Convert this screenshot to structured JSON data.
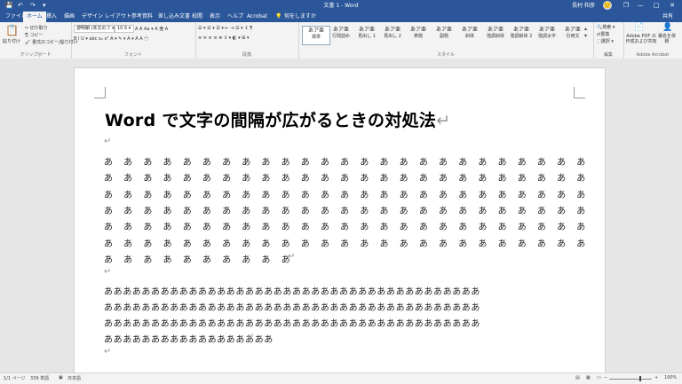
{
  "titlebar": {
    "doc_title": "文書 1 - Word",
    "user": "長村 和彦",
    "avatar": "🙂",
    "minimize": "—",
    "restore": "❐",
    "maximize": "□",
    "close": "✕",
    "save_icon": "💾",
    "undo_icon": "↶",
    "redo_icon": "↷",
    "more_icon": "▾"
  },
  "tabs": {
    "file": "ファイル",
    "home": "ホーム",
    "insert": "挿入",
    "draw": "描画",
    "design": "デザイン",
    "layout": "レイアウト",
    "references": "参考資料",
    "mailings": "差し込み文書",
    "review": "校閲",
    "view": "表示",
    "help": "ヘルプ",
    "acrobat": "Acrobat",
    "tellme": "何をしますか",
    "share": "共有"
  },
  "ribbon": {
    "clipboard": {
      "paste": "貼り付け",
      "cut": "切り取り",
      "copy": "コピー",
      "format_painter": "書式のコピー/貼り付け",
      "label": "クリップボード"
    },
    "font": {
      "font_name": "游明朝 (本文のフ ▾",
      "font_size": "10.5 ▾",
      "label": "フォント",
      "row1_tail": "A A Aa ▾ A 亜 A",
      "row2": "B I U ▾ abc x₂ x² A ▾ ✎ ▾ A ▾ A A ㊀"
    },
    "paragraph": {
      "label": "段落",
      "row1": "☰ ▾ ☰ ▾ ☰ ▾ ⇤ ⇥ ☰ ▾ ↕ ¶",
      "row2": "≡ ≡ ≡ ≡ ≣ ↕ ▾ ◧ ▾ ⊞ ▾"
    },
    "styles": {
      "label": "スタイル",
      "items": [
        {
          "preview": "あア亜",
          "name": "標準"
        },
        {
          "preview": "あア亜",
          "name": "行間詰め"
        },
        {
          "preview": "あア亜",
          "name": "見出し 1"
        },
        {
          "preview": "あア亜",
          "name": "見出し 2"
        },
        {
          "preview": "あア亜",
          "name": "表題"
        },
        {
          "preview": "あア亜",
          "name": "副題"
        },
        {
          "preview": "あア亜",
          "name": "斜体"
        },
        {
          "preview": "あア亜",
          "name": "強調斜体"
        },
        {
          "preview": "あア亜",
          "name": "強調斜体 2"
        },
        {
          "preview": "あア亜",
          "name": "強調太字"
        },
        {
          "preview": "あア亜",
          "name": "引用文"
        }
      ]
    },
    "editing": {
      "find": "検索 ▾",
      "replace": "置換",
      "select": "選択 ▾",
      "label": "編集"
    },
    "acrobat": {
      "create_pdf": "Adobe PDF の作成および共有",
      "sign": "署名を依頼",
      "label": "Adobe Acrobat"
    }
  },
  "document": {
    "heading": "Word で文字の間隔が広がるときの対処法",
    "para_mark": "↵",
    "spaced_rows": [
      "あ あ あ あ あ あ あ あ あ あ あ あ あ あ あ あ あ あ あ あ あ あ あ あ あ",
      "あ あ あ あ あ あ あ あ あ あ あ あ あ あ あ あ あ あ あ あ あ あ あ あ あ",
      "あ あ あ あ あ あ あ あ あ あ あ あ あ あ あ あ あ あ あ あ あ あ あ あ あ",
      "あ あ あ あ あ あ あ あ あ あ あ あ あ あ あ あ あ あ あ あ あ あ あ あ あ",
      "あ あ あ あ あ あ あ あ あ あ あ あ あ あ あ あ あ あ あ あ あ あ あ あ あ",
      "あ あ あ あ あ あ あ あ あ あ あ あ あ あ あ あ あ あ あ あ あ あ あ あ あ",
      "あ あ あ あ あ あ あ あ あ あ"
    ],
    "dense_rows": [
      "ああああああああああああああああああああああああああああああああああああああああ",
      "ああああああああああああああああああああああああああああああああああああああああ",
      "ああああああああああああああああああああああああああああああああああああああああ",
      "ああああああああああああああああああ"
    ]
  },
  "status": {
    "page": "1/1 ページ",
    "words": "339 単語",
    "lang": "日本語",
    "zoom": "190%",
    "zoom_minus": "−",
    "zoom_plus": "+"
  },
  "colors": {
    "brand": "#2b579a"
  }
}
